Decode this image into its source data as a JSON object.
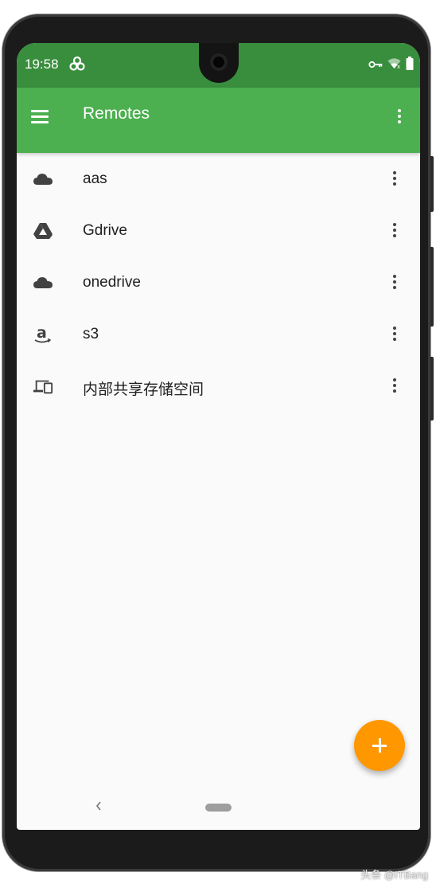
{
  "status_bar": {
    "time": "19:58",
    "icons": [
      "app-logo-icon",
      "vpn-key-icon",
      "wifi-icon",
      "battery-icon"
    ]
  },
  "app_bar": {
    "title": "Remotes",
    "menu_icon": "hamburger-menu-icon",
    "overflow_icon": "more-vert-icon"
  },
  "remotes": [
    {
      "label": "aas",
      "icon": "cloud-icon"
    },
    {
      "label": "Gdrive",
      "icon": "google-drive-icon"
    },
    {
      "label": "onedrive",
      "icon": "cloud-icon"
    },
    {
      "label": "s3",
      "icon": "amazon-icon"
    },
    {
      "label": "内部共享存储空间",
      "icon": "devices-icon"
    }
  ],
  "fab": {
    "icon": "plus-icon"
  },
  "nav": {
    "back_icon": "back-chevron-icon",
    "home_icon": "home-pill-icon"
  },
  "watermark": "头条 @ITBang",
  "colors": {
    "status_bar": "#388e3c",
    "app_bar": "#4caf50",
    "fab": "#ff9800",
    "background": "#fafafa"
  }
}
